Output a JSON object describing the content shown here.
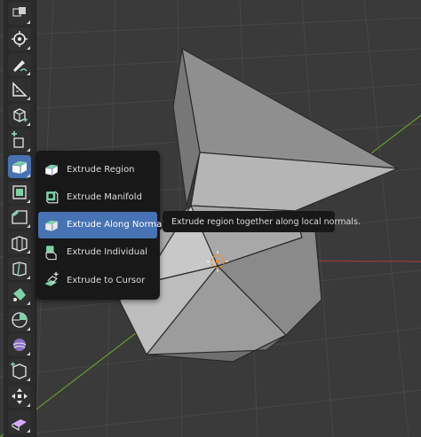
{
  "toolbar": {
    "tools": [
      {
        "name": "select-box-icon"
      },
      {
        "name": "cursor-icon"
      },
      {
        "name": "annotate-icon"
      },
      {
        "name": "measure-icon"
      },
      {
        "name": "add-cube-icon"
      },
      {
        "name": "add-cube-plus-icon"
      },
      {
        "name": "extrude-region-icon",
        "active": true
      },
      {
        "name": "inset-faces-icon"
      },
      {
        "name": "bevel-icon"
      },
      {
        "name": "loop-cut-icon"
      },
      {
        "name": "knife-icon"
      },
      {
        "name": "poly-build-icon"
      },
      {
        "name": "spin-icon"
      },
      {
        "name": "smooth-icon"
      },
      {
        "name": "edge-slide-icon"
      },
      {
        "name": "move-icon"
      },
      {
        "name": "shear-icon"
      }
    ]
  },
  "flyout": {
    "items": [
      {
        "label": "Extrude Region",
        "icon": "extrude-region-icon"
      },
      {
        "label": "Extrude Manifold",
        "icon": "extrude-manifold-icon"
      },
      {
        "label": "Extrude Along Normals",
        "icon": "extrude-along-normals-icon",
        "active": true
      },
      {
        "label": "Extrude Individual",
        "icon": "extrude-individual-icon"
      },
      {
        "label": "Extrude to Cursor",
        "icon": "extrude-to-cursor-icon"
      }
    ]
  },
  "tooltip": {
    "text": "Extrude region together along local normals."
  },
  "colors": {
    "active": "#4772b3",
    "accent_green": "#7fd1a8",
    "axis_x": "#9a3b3b",
    "axis_y": "#6a9a2a",
    "cursor_orange": "#ff8a1c"
  }
}
